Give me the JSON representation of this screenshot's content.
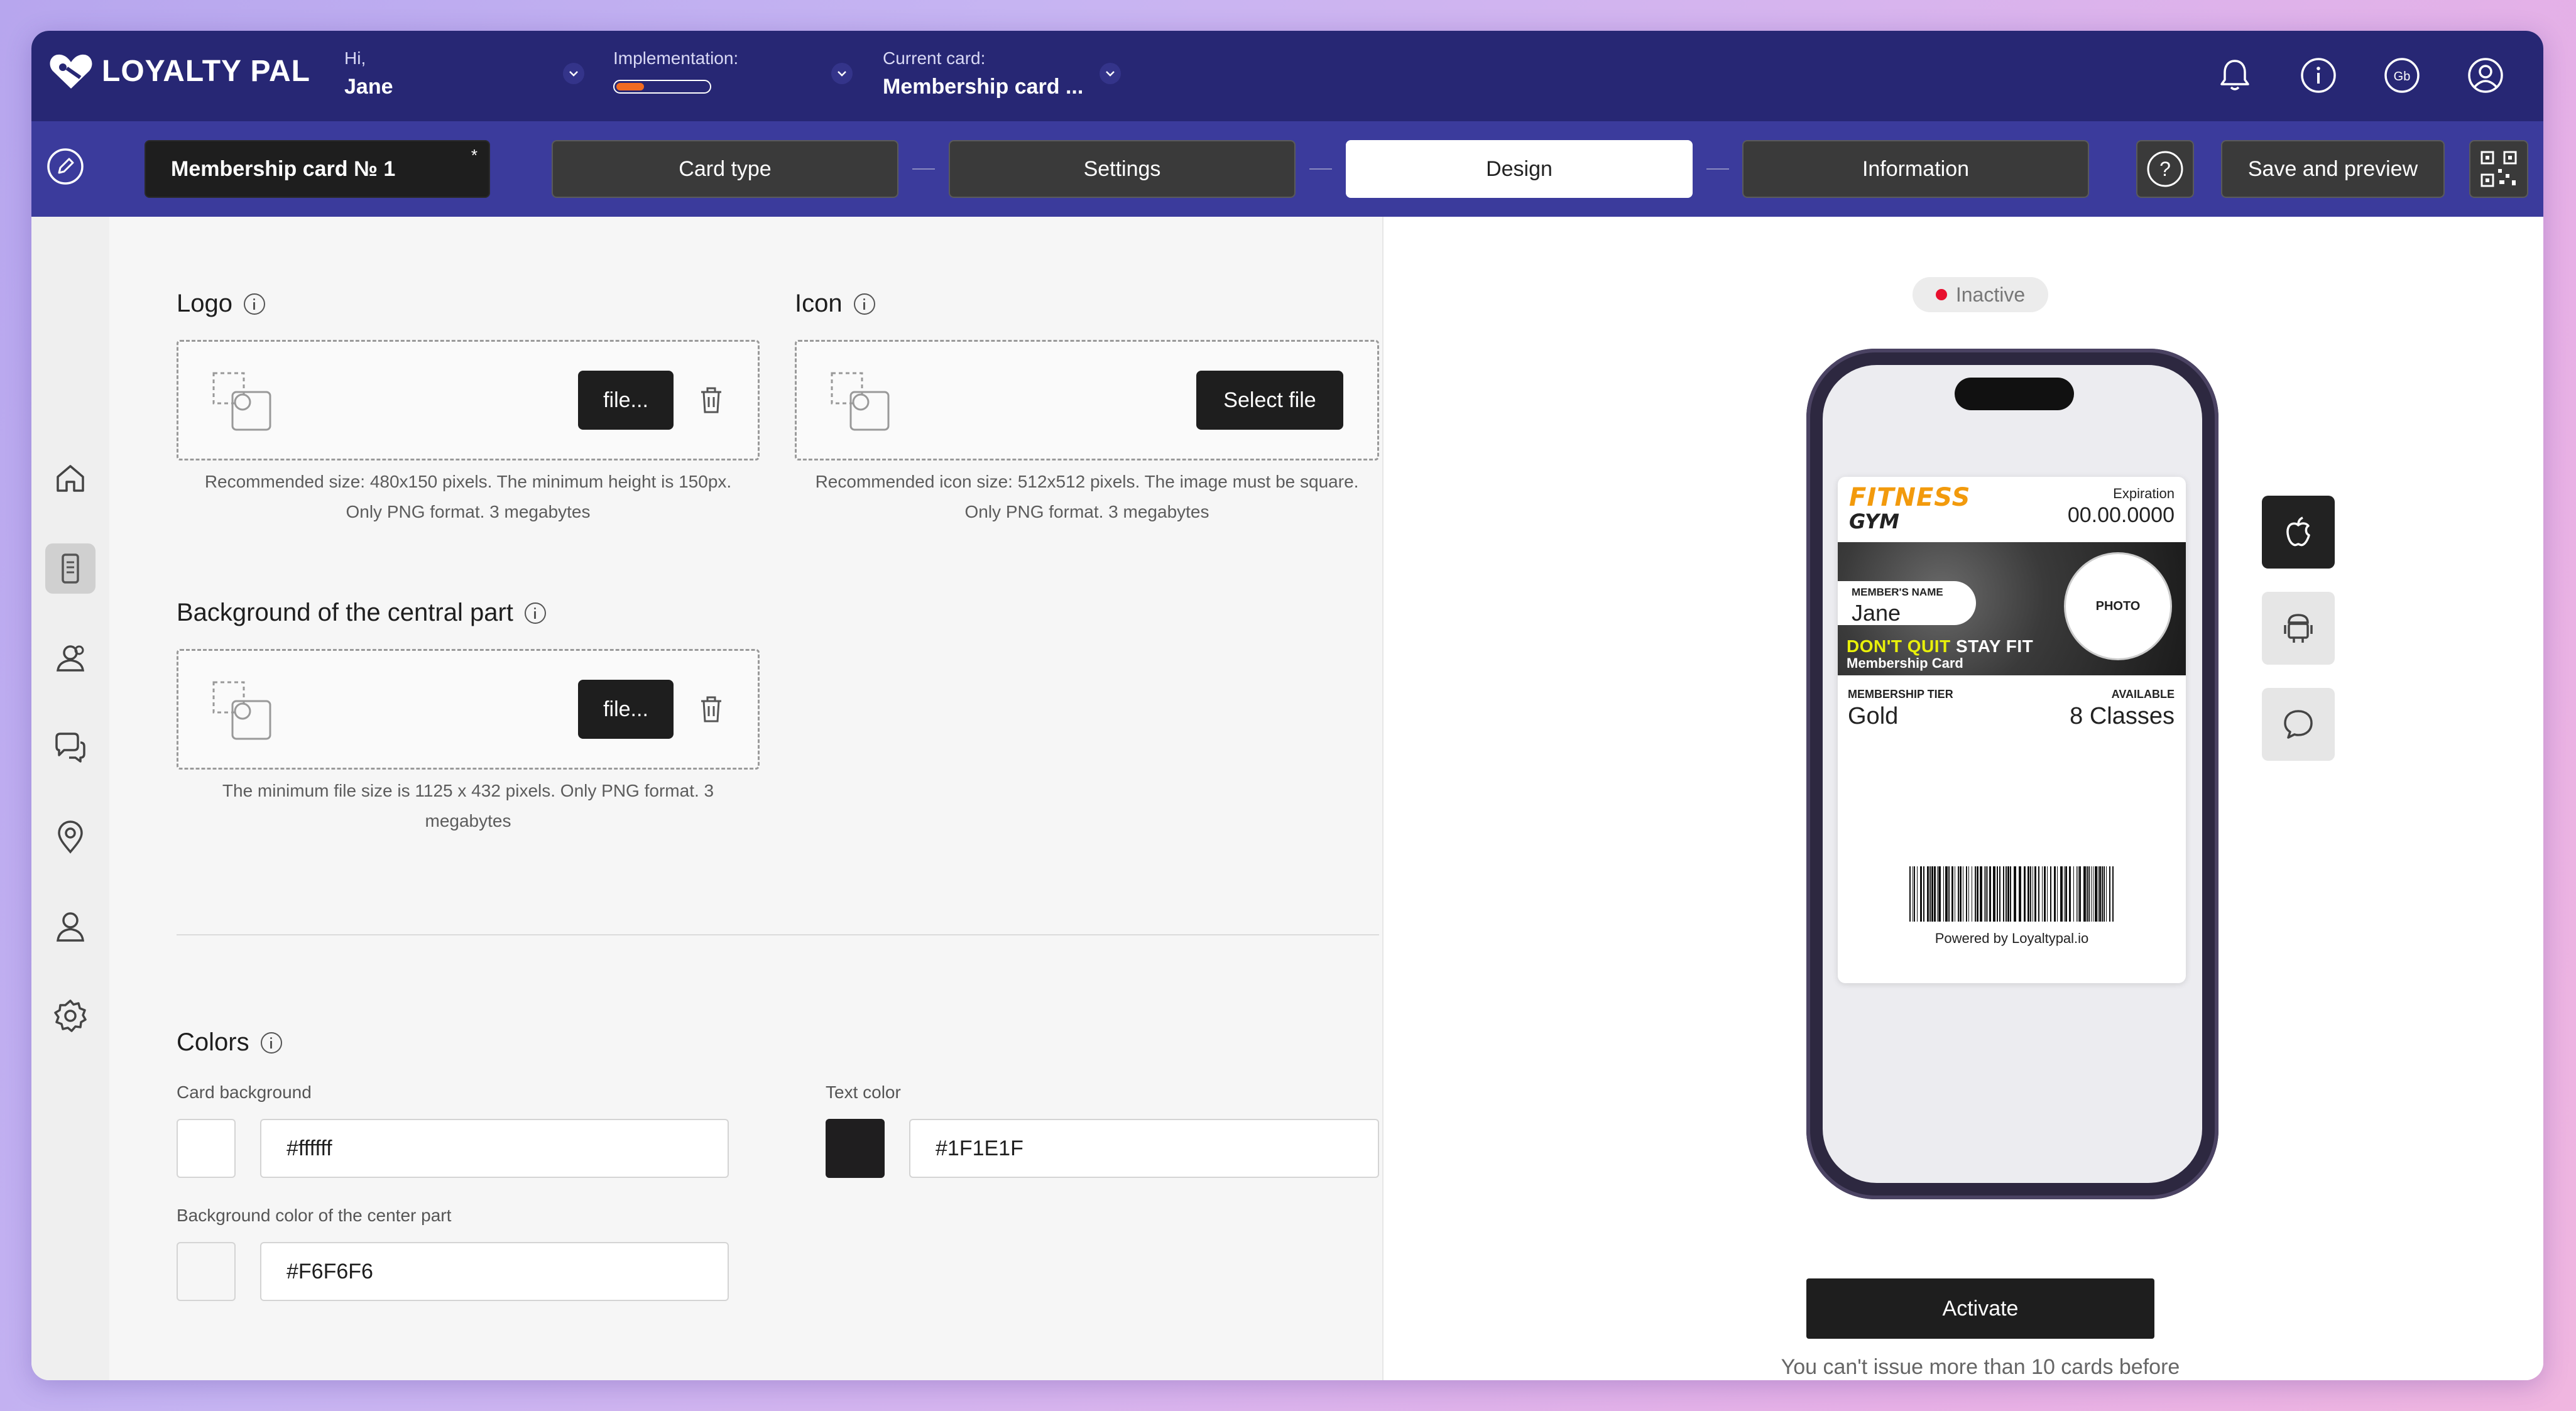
{
  "app": {
    "name": "LOYALTY PAL"
  },
  "header": {
    "greeting": "Hi,",
    "user_name": "Jane",
    "implementation_label": "Implementation:",
    "implementation_progress": 0.3,
    "current_card_label": "Current card:",
    "current_card_value": "Membership card ..."
  },
  "toolbar": {
    "card_name": "Membership card № 1",
    "card_name_marker": "*",
    "steps": [
      {
        "label": "Card type"
      },
      {
        "label": "Settings"
      },
      {
        "label": "Design"
      },
      {
        "label": "Information"
      }
    ],
    "active_step": "Design",
    "help_icon": "question-icon",
    "save_label": "Save and preview",
    "qr_icon": "qr-code-icon"
  },
  "sidebar": {
    "items": [
      {
        "icon": "home-icon"
      },
      {
        "icon": "card-icon"
      },
      {
        "icon": "customers-icon"
      },
      {
        "icon": "chat-icon"
      },
      {
        "icon": "location-icon"
      },
      {
        "icon": "user-icon"
      },
      {
        "icon": "settings-icon"
      }
    ]
  },
  "design": {
    "logo": {
      "title": "Logo",
      "button": "file...",
      "hint_line1": "Recommended size: 480x150 pixels. The minimum height is 150px.",
      "hint_line2": "Only PNG format. 3 megabytes"
    },
    "icon": {
      "title": "Icon",
      "button": "Select file",
      "hint_line1": "Recommended icon size: 512x512 pixels. The image must be square.",
      "hint_line2": "Only PNG format. 3 megabytes"
    },
    "background": {
      "title": "Background of the central part",
      "button": "file...",
      "hint_line1": "The minimum file size is 1125 x 432 pixels. Only PNG format. 3",
      "hint_line2": "megabytes"
    },
    "colors": {
      "title": "Colors",
      "card_background_label": "Card background",
      "card_background_value": "#ffffff",
      "text_color_label": "Text color",
      "text_color_value": "#1F1E1F",
      "center_bg_label": "Background color of the center part",
      "center_bg_value": "#F6F6F6"
    }
  },
  "preview": {
    "status": "Inactive",
    "status_color": "#e8102e",
    "pass": {
      "logo_line1": "FITNESS",
      "logo_line2": "GYM",
      "expiration_label": "Expiration",
      "expiration_value": "00.00.0000",
      "member_label": "MEMBER'S NAME",
      "member_value": "Jane",
      "photo_label": "PHOTO",
      "slogan_highlight": "DON'T QUIT",
      "slogan_rest": "STAY FIT",
      "slogan_sub": "Membership Card",
      "tier_label": "MEMBERSHIP TIER",
      "tier_value": "Gold",
      "available_label": "AVAILABLE",
      "available_value": "8 Classes",
      "powered_by": "Powered by Loyaltypal.io"
    },
    "platforms": [
      "apple-icon",
      "android-icon",
      "message-icon"
    ],
    "activate_label": "Activate",
    "warning": "You can't issue more than 10 cards before"
  },
  "colors": {
    "header_bg": "#272774",
    "stepbar_bg": "#3b3b9c",
    "accent_orange": "#f26b21",
    "dark_button": "#1e1e1e"
  }
}
